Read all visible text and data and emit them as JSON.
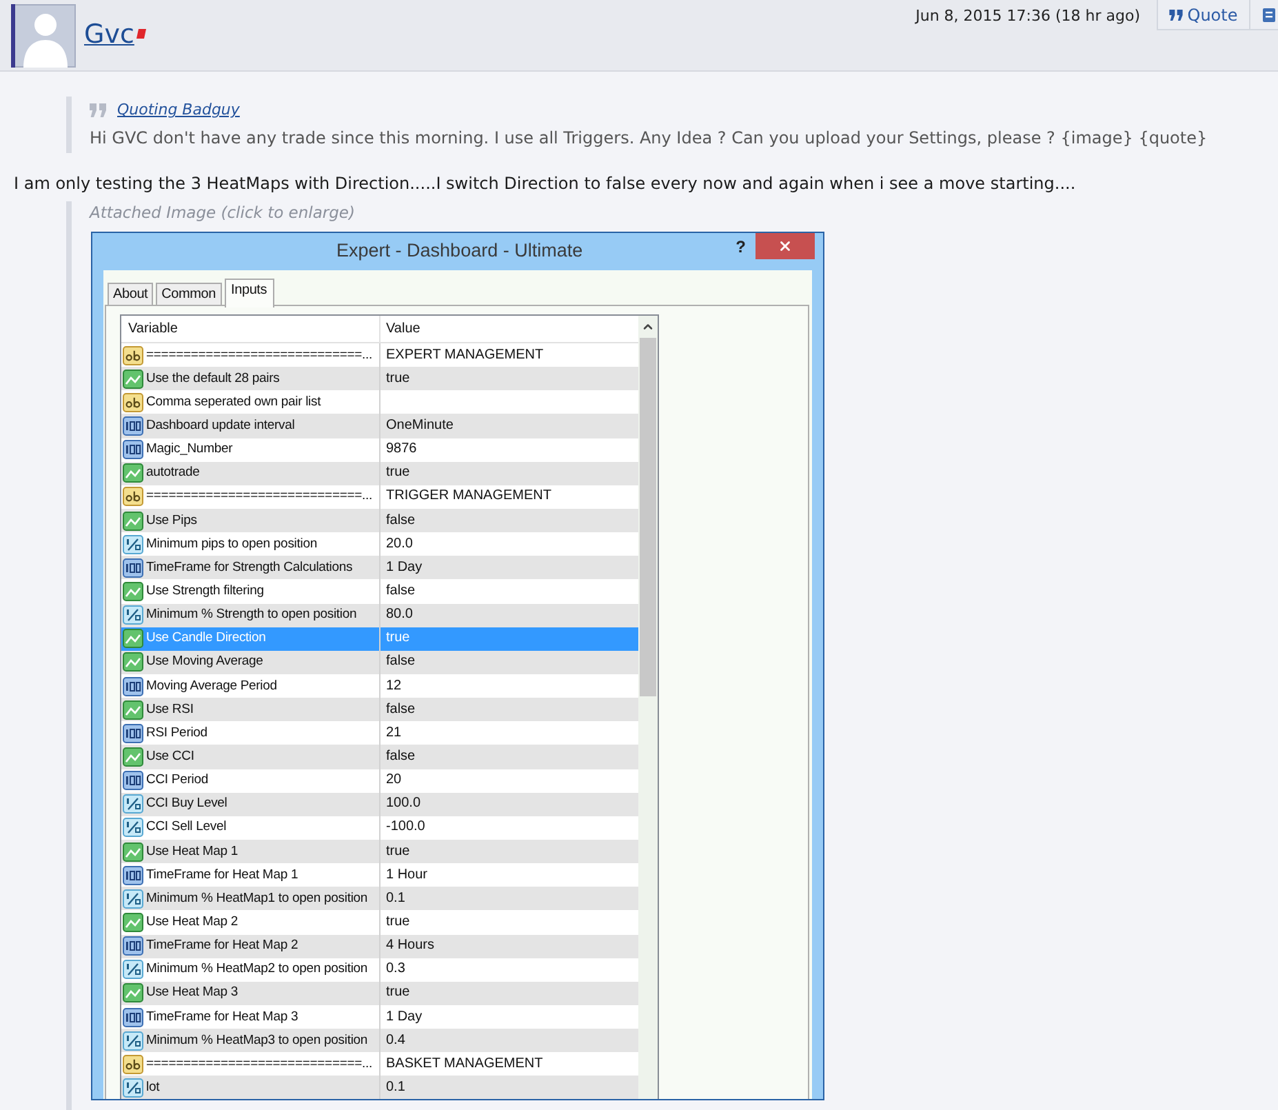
{
  "post": {
    "author": "Gvc",
    "date": "Jun 8, 2015 17:36 (18 hr ago)",
    "quote_button": "Quote"
  },
  "quote": {
    "heading": "Quoting Badguy",
    "text": "Hi GVC don't have any trade since this morning. I use all Triggers. Any Idea ? Can you upload your Settings, please ? {image} {quote}"
  },
  "message": "I am only testing the 3 HeatMaps with Direction.....I switch Direction to false every now and again when i see a move starting....",
  "attachment": {
    "caption": "Attached Image (click to enlarge)",
    "dialog": {
      "title": "Expert - Dashboard - Ultimate",
      "help": "?",
      "tabs": [
        {
          "label": "About",
          "selected": false
        },
        {
          "label": "Common",
          "selected": false
        },
        {
          "label": "Inputs",
          "selected": true
        }
      ],
      "table": {
        "columns": [
          "Variable",
          "Value"
        ],
        "rows": [
          {
            "kind": "string",
            "variable": "=============================...",
            "value": "EXPERT MANAGEMENT",
            "selected": false
          },
          {
            "kind": "bool",
            "variable": "Use the default 28 pairs",
            "value": "true",
            "selected": false
          },
          {
            "kind": "string",
            "variable": "Comma seperated own pair list",
            "selected": false
          },
          {
            "kind": "int",
            "variable": "Dashboard update interval",
            "value": "OneMinute",
            "selected": false
          },
          {
            "kind": "int",
            "variable": "Magic_Number",
            "value": "9876",
            "selected": false
          },
          {
            "kind": "bool",
            "variable": "autotrade",
            "value": "true",
            "selected": false
          },
          {
            "kind": "string",
            "variable": "=============================...",
            "value": "TRIGGER MANAGEMENT",
            "selected": false
          },
          {
            "kind": "bool",
            "variable": "Use Pips",
            "value": "false",
            "selected": false
          },
          {
            "kind": "double",
            "variable": "Minimum pips to open position",
            "value": "20.0",
            "selected": false
          },
          {
            "kind": "int",
            "variable": "TimeFrame for Strength Calculations",
            "value": "1 Day",
            "selected": false
          },
          {
            "kind": "bool",
            "variable": "Use Strength filtering",
            "value": "false",
            "selected": false
          },
          {
            "kind": "double",
            "variable": "Minimum % Strength to open position",
            "value": "80.0",
            "selected": false
          },
          {
            "kind": "bool",
            "variable": "Use Candle Direction",
            "value": "true",
            "selected": true
          },
          {
            "kind": "bool",
            "variable": "Use Moving Average",
            "value": "false",
            "selected": false
          },
          {
            "kind": "int",
            "variable": "Moving Average Period",
            "value": "12",
            "selected": false
          },
          {
            "kind": "bool",
            "variable": "Use RSI",
            "value": "false",
            "selected": false
          },
          {
            "kind": "int",
            "variable": "RSI Period",
            "value": "21",
            "selected": false
          },
          {
            "kind": "bool",
            "variable": "Use CCI",
            "value": "false",
            "selected": false
          },
          {
            "kind": "int",
            "variable": "CCI Period",
            "value": "20",
            "selected": false
          },
          {
            "kind": "double",
            "variable": "CCI Buy Level",
            "value": "100.0",
            "selected": false
          },
          {
            "kind": "double",
            "variable": "CCI Sell Level",
            "value": "-100.0",
            "selected": false
          },
          {
            "kind": "bool",
            "variable": "Use Heat Map 1",
            "value": "true",
            "selected": false
          },
          {
            "kind": "int",
            "variable": "TimeFrame for Heat Map 1",
            "value": "1 Hour",
            "selected": false
          },
          {
            "kind": "double",
            "variable": "Minimum % HeatMap1 to open position",
            "value": "0.1",
            "selected": false
          },
          {
            "kind": "bool",
            "variable": "Use Heat Map 2",
            "value": "true",
            "selected": false
          },
          {
            "kind": "int",
            "variable": "TimeFrame for Heat Map 2",
            "value": "4 Hours",
            "selected": false
          },
          {
            "kind": "double",
            "variable": "Minimum % HeatMap2 to open position",
            "value": "0.3",
            "selected": false
          },
          {
            "kind": "bool",
            "variable": "Use Heat Map 3",
            "value": "true",
            "selected": false
          },
          {
            "kind": "int",
            "variable": "TimeFrame for Heat Map 3",
            "value": "1 Day",
            "selected": false
          },
          {
            "kind": "double",
            "variable": "Minimum % HeatMap3 to open position",
            "value": "0.4",
            "selected": false
          },
          {
            "kind": "string",
            "variable": "=============================...",
            "value": "BASKET MANAGEMENT",
            "selected": false
          },
          {
            "kind": "double",
            "variable": "lot",
            "value": "0.1",
            "selected": false
          }
        ]
      }
    }
  }
}
